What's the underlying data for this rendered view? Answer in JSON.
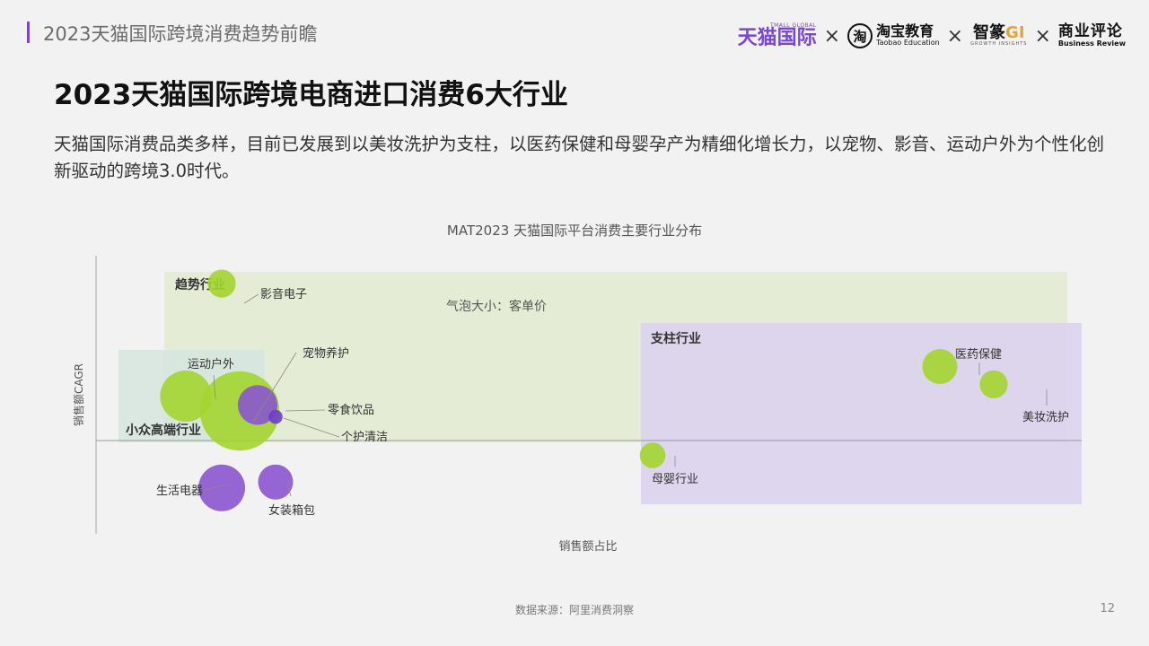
{
  "header": {
    "title": "2023天猫国际跨境消费趋势前瞻",
    "logos": {
      "tmall_small": "TMALL GLOBAL",
      "tmall": "天猫国际",
      "taobao_icon": "淘",
      "taobao_cn": "淘宝教育",
      "taobao_en": "Taobao Education",
      "gi_cn": "智篆",
      "gi_mark": "GI",
      "gi_en": "GROWTH INSIGHTS",
      "br_cn": "商业评论",
      "br_en": "Business Review",
      "separator": "×"
    }
  },
  "main": {
    "title": "2023天猫国际跨境电商进口消费6大行业",
    "description": "天猫国际消费品类多样，目前已发展到以美妆洗护为支柱，以医药保健和母婴孕产为精细化增长力，以宠物、影音、运动户外为个性化创新驱动的跨境3.0时代。"
  },
  "chart_data": {
    "type": "scatter",
    "title": "MAT2023 天猫国际平台消费主要行业分布",
    "xlabel": "销售额占比",
    "ylabel": "销售额CAGR",
    "note": "气泡大小：客单价",
    "grid": false,
    "regions": [
      {
        "label": "趋势行业",
        "color": "#e3ebd3"
      },
      {
        "label": "小众高端行业",
        "color": "#d6e6de"
      },
      {
        "label": "支柱行业",
        "color": "#dbd3ee"
      }
    ],
    "points": [
      {
        "label": "影音电子",
        "x": 0.07,
        "y": 0.53,
        "size": 1.2,
        "color": "#a3d530"
      },
      {
        "label": "运动户外",
        "x": 0.05,
        "y": 0.15,
        "size": 2.2,
        "color": "#a3d530"
      },
      {
        "label": "宠物养护",
        "x": 0.08,
        "y": 0.1,
        "size": 3.4,
        "color": "#a3d530"
      },
      {
        "label": "零食饮品",
        "x": 0.09,
        "y": 0.12,
        "size": 1.7,
        "color": "#8a55cf"
      },
      {
        "label": "个护清洁",
        "x": 0.1,
        "y": 0.08,
        "size": 0.6,
        "color": "#6d3ec9"
      },
      {
        "label": "生活电器",
        "x": 0.07,
        "y": -0.16,
        "size": 2.0,
        "color": "#8a55cf"
      },
      {
        "label": "女装箱包",
        "x": 0.1,
        "y": -0.14,
        "size": 1.5,
        "color": "#8a55cf"
      },
      {
        "label": "母婴行业",
        "x": 0.31,
        "y": -0.05,
        "size": 1.1,
        "color": "#a3d530"
      },
      {
        "label": "医药保健",
        "x": 0.47,
        "y": 0.25,
        "size": 1.5,
        "color": "#a3d530"
      },
      {
        "label": "美妆洗护",
        "x": 0.5,
        "y": 0.19,
        "size": 1.2,
        "color": "#a3d530"
      }
    ]
  },
  "footer": {
    "source": "数据来源：阿里消费洞察",
    "page": "12"
  }
}
